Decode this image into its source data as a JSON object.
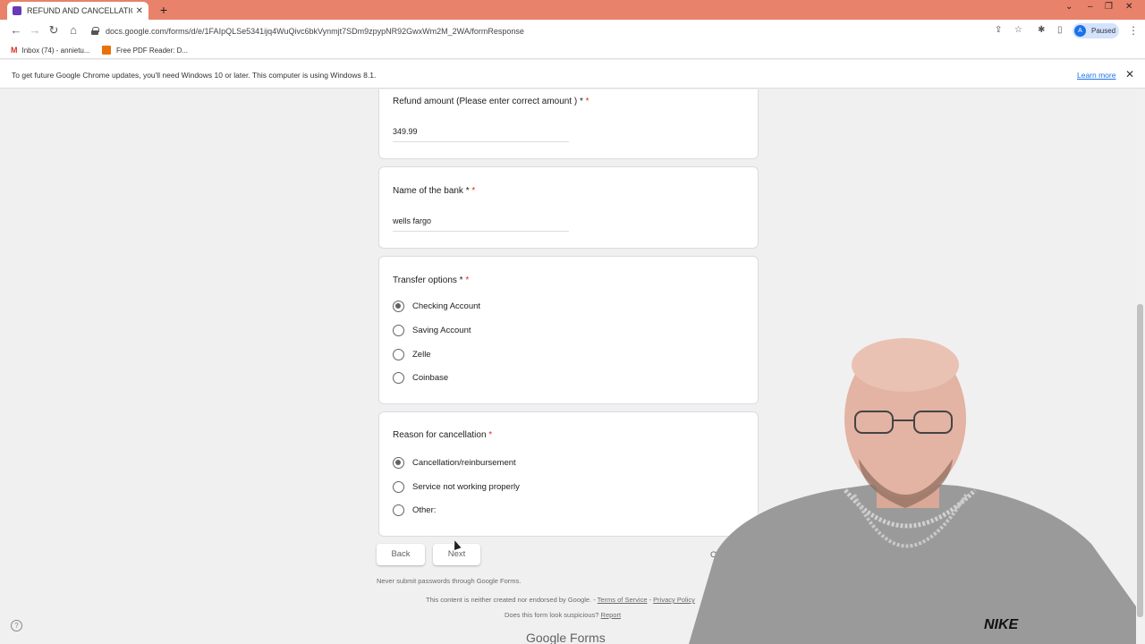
{
  "browser": {
    "tab_title": "REFUND AND CANCELLATION F",
    "url": "docs.google.com/forms/d/e/1FAIpQLSe5341ijq4WuQivc6bkVynmjt7SDm9zpypNR92GwxWm2M_2WA/formResponse",
    "profile_initial": "A",
    "profile_status": "Paused",
    "bookmarks": [
      {
        "label": "Inbox (74) - annietu..."
      },
      {
        "label": "Free PDF Reader: D..."
      }
    ],
    "infobar": {
      "message": "To get future Google Chrome updates, you'll need Windows 10 or later. This computer is using Windows 8.1.",
      "link": "Learn more"
    }
  },
  "form": {
    "refund_amount": {
      "label": "Refund amount (Please enter correct amount ) * ",
      "required": "*",
      "value": "349.99"
    },
    "bank_name": {
      "label": "Name of the bank * ",
      "required": "*",
      "value": "wells fargo"
    },
    "transfer_options": {
      "label": "Transfer options * ",
      "required": "*",
      "options": [
        "Checking Account",
        "Saving Account",
        "Zelle",
        "Coinbase"
      ],
      "selected": "Checking Account"
    },
    "reason": {
      "label": "Reason for cancellation ",
      "required": "*",
      "options": [
        "Cancellation/reinbursement",
        "Service not working properly",
        "Other:"
      ],
      "selected": "Cancellation/reinbursement"
    },
    "buttons": {
      "back": "Back",
      "next": "Next",
      "clear": "Clear fo"
    }
  },
  "footer": {
    "password_warning": "Never submit passwords through Google Forms.",
    "disclaimer": "This content is neither created nor endorsed by Google. - ",
    "terms": "Terms of Service",
    "separator": " - ",
    "privacy": "Privacy Policy",
    "suspicious": "Does this form look suspicious? ",
    "report": "Report",
    "brand": "Google Forms"
  },
  "webcam": {
    "shirt_logo": "NIKE"
  }
}
